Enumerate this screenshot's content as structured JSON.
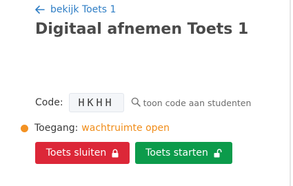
{
  "back_link": {
    "label": "bekijk Toets 1",
    "icon": "arrow-left-icon"
  },
  "page_title": "Digitaal afnemen Toets 1",
  "code": {
    "label": "Code:",
    "value": "HKHH",
    "show_code_label": "toon code aan studenten",
    "show_code_icon": "search-icon"
  },
  "access": {
    "label": "Toegang:",
    "status": "wachtruimte open",
    "status_color": "#f39223"
  },
  "buttons": {
    "close_label": "Toets sluiten",
    "close_icon": "lock-closed-icon",
    "close_color": "#dc2738",
    "start_label": "Toets starten",
    "start_icon": "lock-open-icon",
    "start_color": "#0c9b4b"
  }
}
